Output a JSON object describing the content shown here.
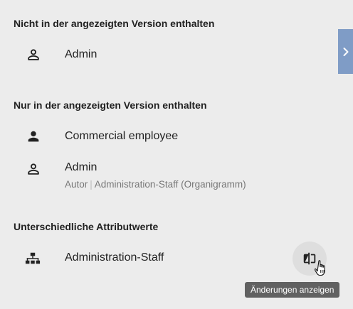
{
  "sections": {
    "removed": {
      "title": "Nicht in der angezeigten Version enthalten",
      "items": [
        {
          "icon": "person-outline-icon",
          "label": "Admin"
        }
      ]
    },
    "added": {
      "title": "Nur in der angezeigten Version enthalten",
      "items": [
        {
          "icon": "person-filled-icon",
          "label": "Commercial employee"
        },
        {
          "icon": "person-outline-icon",
          "label": "Admin",
          "role": "Autor",
          "separator": "|",
          "context": "Administration-Staff (Organigramm)"
        }
      ]
    },
    "changed": {
      "title": "Unterschiedliche Attributwerte",
      "items": [
        {
          "icon": "org-chart-icon",
          "label": "Administration-Staff",
          "action_icon": "compare-icon",
          "action_tooltip": "Änderungen anzeigen"
        }
      ]
    }
  },
  "side_tab": {
    "icon": "chevron-right-icon"
  },
  "colors": {
    "background": "#ececec",
    "side_tab": "#7f9cc6",
    "tooltip": "#616161"
  }
}
